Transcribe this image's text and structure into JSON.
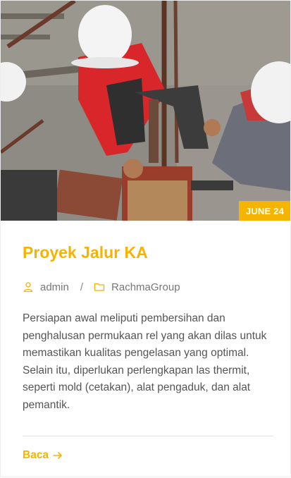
{
  "post": {
    "date_badge": "JUNE 24",
    "title": "Proyek Jalur KA",
    "author": "admin",
    "separator": "/",
    "category": "RachmaGroup",
    "excerpt": "Persiapan awal meliputi pembersihan dan penghalusan permukaan rel yang akan dilas untuk memastikan kualitas pengelasan yang optimal. Selain itu, diperlukan perlengkapan las thermit, seperti mold (cetakan), alat pengaduk, dan alat pemantik.",
    "read_more": "Baca"
  },
  "colors": {
    "accent": "#f5b400",
    "text": "#555555",
    "meta": "#777777"
  },
  "icons": {
    "author": "user-icon",
    "category": "folder-icon",
    "read_more": "arrow-right-icon"
  }
}
